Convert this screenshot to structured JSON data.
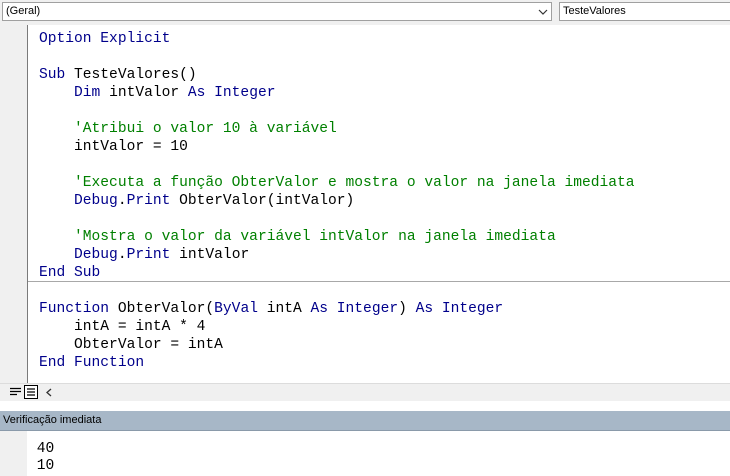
{
  "object_dropdown": {
    "value": "(Geral)"
  },
  "procedure_dropdown": {
    "value": "TesteValores"
  },
  "colors": {
    "keyword": "#00008b",
    "comment": "#008000",
    "text": "#000000",
    "immediate_title_bg": "#a7b7c7"
  },
  "icons": {
    "object_dropdown_arrow": "chevron-down-icon",
    "procedure_view": "procedure-view-icon",
    "full_module_view": "full-module-view-icon",
    "scroll_left": "scroll-left-arrow-icon"
  },
  "code": {
    "lines": [
      [
        {
          "t": "kw",
          "v": "Option Explicit"
        }
      ],
      [],
      [
        {
          "t": "kw",
          "v": "Sub "
        },
        {
          "t": "tx",
          "v": "TesteValores()"
        }
      ],
      [
        {
          "t": "tx",
          "v": "    "
        },
        {
          "t": "kw",
          "v": "Dim "
        },
        {
          "t": "tx",
          "v": "intValor "
        },
        {
          "t": "kw",
          "v": "As Integer"
        }
      ],
      [],
      [
        {
          "t": "tx",
          "v": "    "
        },
        {
          "t": "cm",
          "v": "'Atribui o valor 10 à variável"
        }
      ],
      [
        {
          "t": "tx",
          "v": "    intValor = 10"
        }
      ],
      [],
      [
        {
          "t": "tx",
          "v": "    "
        },
        {
          "t": "cm",
          "v": "'Executa a função ObterValor e mostra o valor na janela imediata"
        }
      ],
      [
        {
          "t": "tx",
          "v": "    "
        },
        {
          "t": "kw",
          "v": "Debug"
        },
        {
          "t": "tx",
          "v": "."
        },
        {
          "t": "kw",
          "v": "Print"
        },
        {
          "t": "tx",
          "v": " ObterValor(intValor)"
        }
      ],
      [],
      [
        {
          "t": "tx",
          "v": "    "
        },
        {
          "t": "cm",
          "v": "'Mostra o valor da variável intValor na janela imediata"
        }
      ],
      [
        {
          "t": "tx",
          "v": "    "
        },
        {
          "t": "kw",
          "v": "Debug"
        },
        {
          "t": "tx",
          "v": "."
        },
        {
          "t": "kw",
          "v": "Print"
        },
        {
          "t": "tx",
          "v": " intValor"
        }
      ],
      [
        {
          "t": "kw",
          "v": "End Sub"
        }
      ],
      [],
      [
        {
          "t": "kw",
          "v": "Function "
        },
        {
          "t": "tx",
          "v": "ObterValor("
        },
        {
          "t": "kw",
          "v": "ByVal "
        },
        {
          "t": "tx",
          "v": "intA "
        },
        {
          "t": "kw",
          "v": "As Integer"
        },
        {
          "t": "tx",
          "v": ") "
        },
        {
          "t": "kw",
          "v": "As Integer"
        }
      ],
      [
        {
          "t": "tx",
          "v": "    intA = intA * 4"
        }
      ],
      [
        {
          "t": "tx",
          "v": "    ObterValor = intA"
        }
      ],
      [
        {
          "t": "kw",
          "v": "End Function"
        }
      ]
    ]
  },
  "immediate": {
    "title": "Verificação imediata",
    "lines": [
      "40",
      "10"
    ]
  }
}
